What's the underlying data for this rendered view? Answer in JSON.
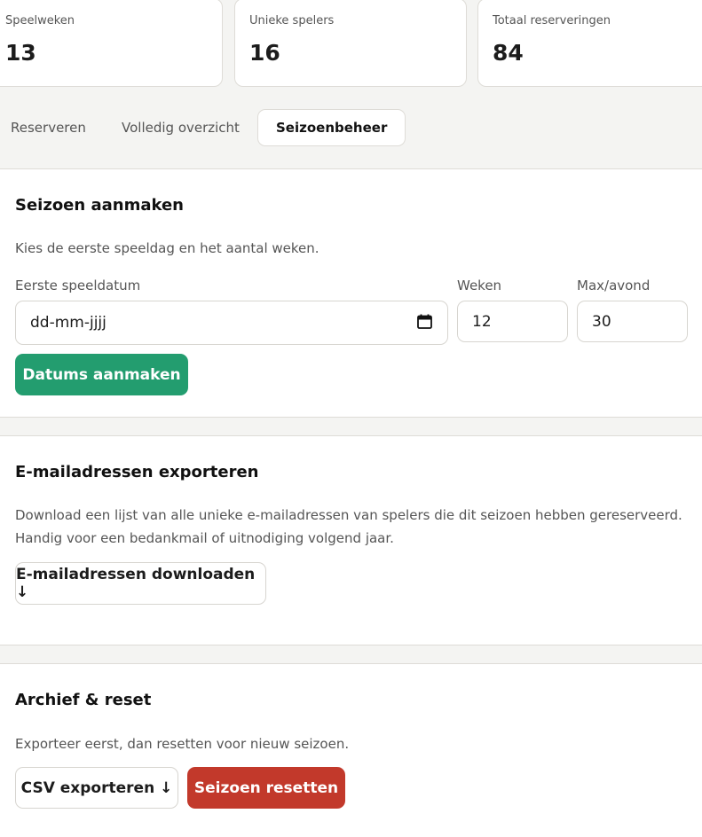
{
  "stats": [
    {
      "label": "Speelweken",
      "value": "13"
    },
    {
      "label": "Unieke spelers",
      "value": "16"
    },
    {
      "label": "Totaal reserveringen",
      "value": "84"
    }
  ],
  "tabs": {
    "reserveren": "Reserveren",
    "overzicht": "Volledig overzicht",
    "seizoenbeheer": "Seizoenbeheer",
    "active": "seizoenbeheer"
  },
  "create_season": {
    "title": "Seizoen aanmaken",
    "description": "Kies de eerste speeldag en het aantal weken.",
    "date_label": "Eerste speeldatum",
    "date_placeholder": "dd-mm-jjjj",
    "weeks_label": "Weken",
    "weeks_value": "12",
    "max_label": "Max/avond",
    "max_value": "30",
    "submit_label": "Datums aanmaken"
  },
  "export_emails": {
    "title": "E-mailadressen exporteren",
    "description_line1": "Download een lijst van alle unieke e-mailadressen van spelers die dit seizoen hebben gereserveerd.",
    "description_line2": "Handig voor een bedankmail of uitnodiging volgend jaar.",
    "download_label": "E-mailadressen downloaden ↓"
  },
  "archive": {
    "title": "Archief & reset",
    "description": "Exporteer eerst, dan resetten voor nieuw seizoen.",
    "csv_label": "CSV exporteren ↓",
    "reset_label": "Seizoen resetten"
  },
  "colors": {
    "primary_green": "#239d6f",
    "danger_red": "#c2392b",
    "background": "#f4f4f2",
    "card": "#ffffff",
    "border": "#dedcd7"
  },
  "icons": {
    "date_picker": "calendar-icon"
  }
}
